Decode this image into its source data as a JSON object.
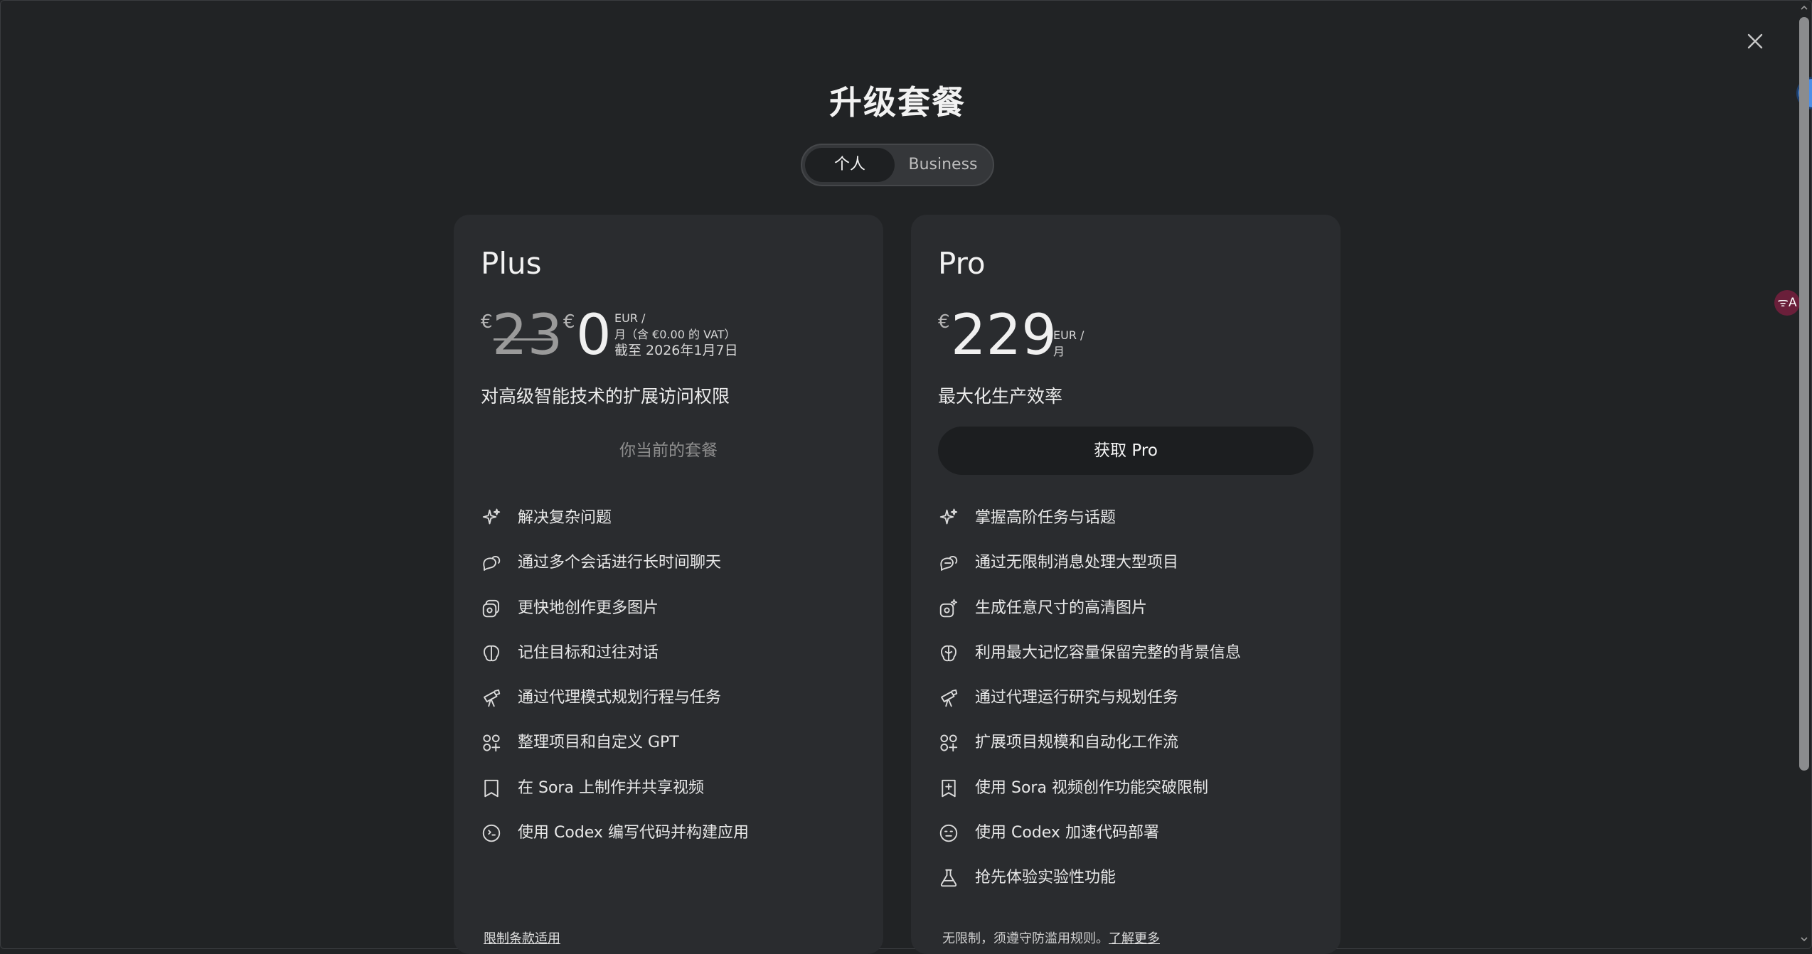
{
  "modal": {
    "title": "升级套餐",
    "close_icon": "close-icon"
  },
  "toggle": {
    "personal_label": "个人",
    "business_label": "Business",
    "selected": "个人"
  },
  "plans": {
    "plus": {
      "name": "Plus",
      "currency_symbol": "€",
      "original_price": "23",
      "price": "0",
      "price_note_line1": "EUR /",
      "price_note_line2": "月（含 €0.00 的 VAT）",
      "price_note_line3": "截至 2026年1月7日",
      "tagline": "对高级智能技术的扩展访问权限",
      "button_label": "你当前的套餐",
      "features": [
        {
          "icon": "sparkle-icon",
          "text": "解决复杂问题"
        },
        {
          "icon": "chat-bubbles-icon",
          "text": "通过多个会话进行长时间聊天"
        },
        {
          "icon": "image-icon",
          "text": "更快地创作更多图片"
        },
        {
          "icon": "brain-icon",
          "text": "记住目标和过往对话"
        },
        {
          "icon": "telescope-icon",
          "text": "通过代理模式规划行程与任务"
        },
        {
          "icon": "apps-icon",
          "text": "整理项目和自定义 GPT"
        },
        {
          "icon": "video-icon",
          "text": "在 Sora 上制作并共享视频"
        },
        {
          "icon": "code-icon",
          "text": "使用 Codex 编写代码并构建应用"
        }
      ],
      "footer_link": "限制条款适用"
    },
    "pro": {
      "name": "Pro",
      "currency_symbol": "€",
      "price": "229",
      "price_note_line1": "EUR /",
      "price_note_line2": "月",
      "tagline": "最大化生产效率",
      "button_label": "获取 Pro",
      "features": [
        {
          "icon": "sparkle-icon",
          "text": "掌握高阶任务与话题"
        },
        {
          "icon": "chat-bubbles-icon",
          "text": "通过无限制消息处理大型项目"
        },
        {
          "icon": "image-sparkle-icon",
          "text": "生成任意尺寸的高清图片"
        },
        {
          "icon": "brain-icon",
          "text": "利用最大记忆容量保留完整的背景信息"
        },
        {
          "icon": "telescope-icon",
          "text": "通过代理运行研究与规划任务"
        },
        {
          "icon": "apps-icon",
          "text": "扩展项目规模和自动化工作流"
        },
        {
          "icon": "video-icon",
          "text": "使用 Sora 视频创作功能突破限制"
        },
        {
          "icon": "code-icon",
          "text": "使用 Codex 加速代码部署"
        },
        {
          "icon": "flask-icon",
          "text": "抢先体验实验性功能"
        }
      ],
      "footer_text": "无限制，须遵守防滥用规则。",
      "footer_link": "了解更多"
    }
  },
  "side": {
    "translate_badge": "ᯤA"
  }
}
